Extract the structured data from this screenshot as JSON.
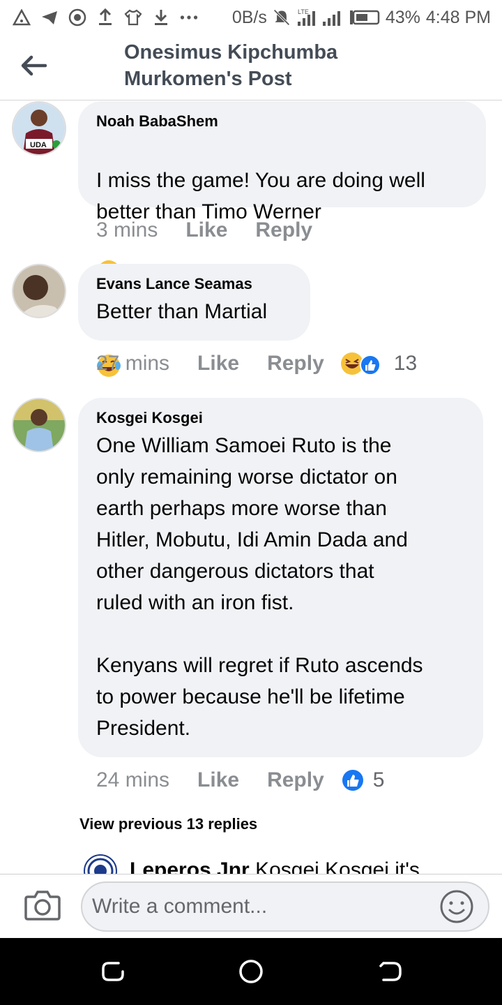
{
  "status_bar": {
    "speed": "0B/s",
    "network": "LTE",
    "battery": "43%",
    "time": "4:48 PM",
    "icons": [
      "warning-icon",
      "telegram-icon",
      "vpn-icon",
      "upload-icon",
      "shirt-icon",
      "download-icon",
      "more-icon",
      "mute-icon",
      "signal-icon",
      "battery-icon"
    ]
  },
  "header": {
    "title_line1": "Onesimus Kipchumba",
    "title_line2": "Murkomen's Post",
    "back_icon": "back-arrow-icon"
  },
  "comments": [
    {
      "author": "Noah BabaShem",
      "text": "I miss the game! You are doing well better than Timo Werner",
      "emojis": [
        "laughing-tears",
        "laughing-tears"
      ],
      "time": "3 mins",
      "like": "Like",
      "reply": "Reply",
      "avatar_badge": "UDA"
    },
    {
      "author": "Evans Lance Seamas",
      "text": "Better than Martial",
      "time": "27 mins",
      "like": "Like",
      "reply": "Reply",
      "reactions": [
        "haha",
        "like"
      ],
      "reaction_count": "13"
    },
    {
      "author": "Kosgei Kosgei",
      "text": "One  William Samoei Ruto is the\nonly remaining worse dictator on\nearth perhaps more worse than\nHitler, Mobutu, Idi Amin Dada and\nother dangerous dictators that\nruled with an iron fist.\n\nKenyans will regret if Ruto ascends\nto power because he'll be lifetime\nPresident.",
      "time": "24 mins",
      "like": "Like",
      "reply": "Reply",
      "reactions": [
        "like"
      ],
      "reaction_count": "5"
    }
  ],
  "view_previous": "View previous 13 replies",
  "partial_reply": {
    "author": "Leperos Jnr",
    "text": "Kosgei Kosgei it's"
  },
  "composer": {
    "placeholder": "Write a comment..."
  },
  "colors": {
    "bubble": "#f0f2f5",
    "meta_text": "#8a8d91",
    "like_blue": "#1877f2",
    "haha_yellow": "#f7c23a"
  }
}
